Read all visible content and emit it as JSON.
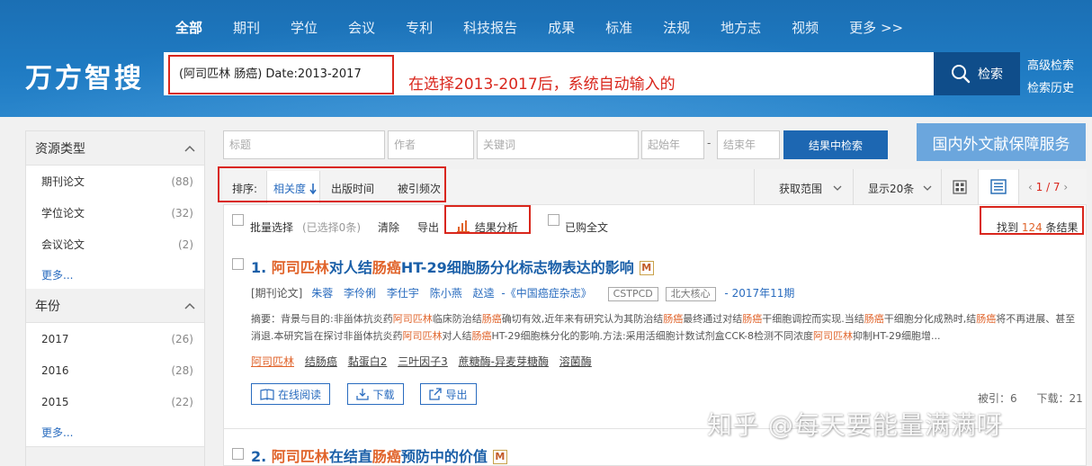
{
  "header": {
    "nav": [
      "全部",
      "期刊",
      "学位",
      "会议",
      "专利",
      "科技报告",
      "成果",
      "标准",
      "法规",
      "地方志",
      "视频",
      "更多 >>"
    ],
    "logo": "万方智搜",
    "search_value": "(阿司匹林 肠癌) Date:2013-2017",
    "annotation": "在选择2013-2017后，系统自动输入的",
    "search_button": "检索",
    "advanced_search": "高级检索",
    "search_history": "检索历史"
  },
  "sidebar": {
    "resource_type": {
      "title": "资源类型",
      "items": [
        {
          "label": "期刊论文",
          "count": "(88)"
        },
        {
          "label": "学位论文",
          "count": "(32)"
        },
        {
          "label": "会议论文",
          "count": "(2)"
        }
      ],
      "more": "更多..."
    },
    "year": {
      "title": "年份",
      "items": [
        {
          "label": "2017",
          "count": "(26)"
        },
        {
          "label": "2016",
          "count": "(28)"
        },
        {
          "label": "2015",
          "count": "(22)"
        }
      ],
      "more": "更多..."
    }
  },
  "filters": {
    "title_placeholder": "标题",
    "author_placeholder": "作者",
    "keyword_placeholder": "关键词",
    "start_year_placeholder": "起始年",
    "dash": "-",
    "end_year_placeholder": "结束年",
    "search_in_results": "结果中检索",
    "service_button": "国内外文献保障服务"
  },
  "sortbar": {
    "label": "排序:",
    "relevance": "相关度",
    "pub_time": "出版时间",
    "cited": "被引频次",
    "range": "获取范围",
    "display": "显示20条",
    "pagination": "1 / 7"
  },
  "actions": {
    "batch_select": "批量选择",
    "selected": "(已选择0条)",
    "clear": "清除",
    "export": "导出",
    "analysis": "结果分析",
    "purchased": "已购全文",
    "found_prefix": "找到 ",
    "found_count": "124",
    "found_suffix": " 条结果"
  },
  "results": [
    {
      "num": "1.",
      "title_hl1": "阿司匹林",
      "title_mid": "对人结",
      "title_hl2": "肠癌",
      "title_rest": "HT-29细胞肠分化标志物表达的影响",
      "badge": "M",
      "type": "[期刊论文]",
      "authors": [
        "朱蓉",
        "李伶俐",
        "李仕宇",
        "陈小燕",
        "赵逵"
      ],
      "journal": "-《中国癌症杂志》",
      "tags": [
        "CSTPCD",
        "北大核心"
      ],
      "date": "- 2017年11期",
      "abstract_parts": [
        "摘要：背景与目的:非甾体抗炎药",
        "阿司匹林",
        "临床防治结",
        "肠癌",
        "确切有效,近年来有研究认为其防治结",
        "肠癌",
        "最终通过对结",
        "肠癌",
        "干细胞调控而实现.当结",
        "肠癌",
        "干细胞分化成熟时,结",
        "肠癌",
        "将不再进展、甚至消退.本研究旨在探讨非甾体抗炎药",
        "阿司匹林",
        "对人结",
        "肠癌",
        "HT-29细胞株分化的影响.方法:采用活细胞计数试剂盒CCK-8检测不同浓度",
        "阿司匹林",
        "抑制HT-29细胞增..."
      ],
      "keywords": [
        "阿司匹林",
        "结肠癌",
        "黏蛋白2",
        "三叶因子3",
        "蔗糖酶-异麦芽糖酶",
        "溶菌酶"
      ],
      "read_online": "在线阅读",
      "download": "下载",
      "export": "导出",
      "cited": "被引：6",
      "downloads": "下载：21"
    },
    {
      "num": "2.",
      "title_hl1": "阿司匹林",
      "title_mid": "在结直",
      "title_hl2": "肠癌",
      "title_rest": "预防中的价值",
      "badge": "M"
    }
  ],
  "watermark": "知乎 @每天要能量满满呀",
  "colors": {
    "brand_blue": "#1f7bc3",
    "highlight_red": "#d9261c",
    "keyword_orange": "#e0632a",
    "link_blue": "#2a6cbf"
  }
}
